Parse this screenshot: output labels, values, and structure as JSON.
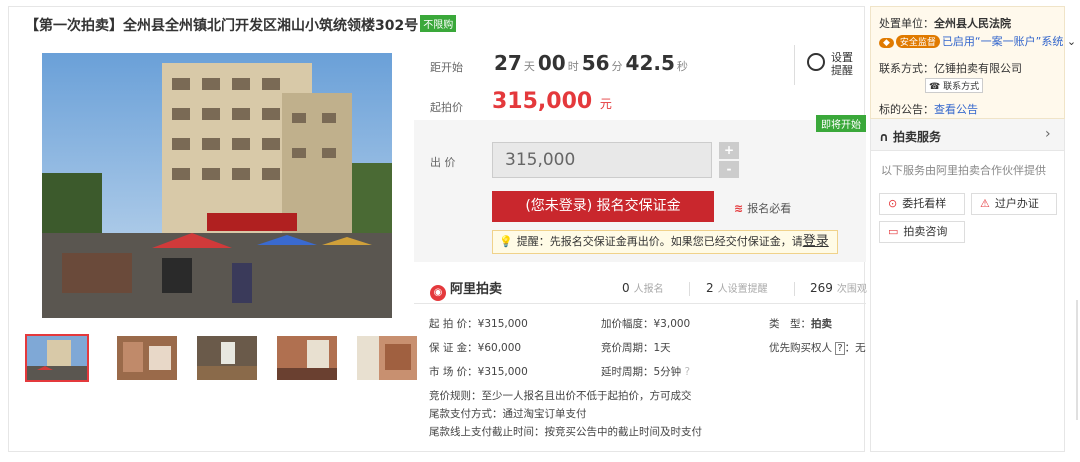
{
  "title": "【第一次拍卖】全州县全州镇北门开发区湘山小筑统领楼302号",
  "title_badge": "不限购",
  "countdown": {
    "label": "距开始",
    "days": "27",
    "days_unit": "天",
    "hours": "00",
    "hours_unit": "时",
    "minutes": "56",
    "minutes_unit": "分",
    "seconds": "42.5",
    "seconds_unit": "秒"
  },
  "start_price": {
    "label": "起拍价",
    "value": "315,000",
    "unit": "元"
  },
  "reminder": {
    "line1": "设置",
    "line2": "提醒",
    "icon": "clock-icon"
  },
  "status_tag": "即将开始",
  "bid": {
    "label": "出 价",
    "input_value": "315,000",
    "plus": "+",
    "minus": "-",
    "signup_button": "(您未登录) 报名交保证金",
    "must_read": "报名必看",
    "tip_prefix": "提醒：先报名交保证金再出价。如果您已经交付保证金，请",
    "tip_link": "登录"
  },
  "stats": {
    "brand": "阿里拍卖",
    "signup_count": "0",
    "signup_label": "人报名",
    "remind_count": "2",
    "remind_label": "人设置提醒",
    "view_count": "269",
    "view_label": "次围观"
  },
  "info": {
    "start_price": "起 拍 价：¥315,000",
    "increment": "加价幅度：¥3,000",
    "type_label": "类　型：",
    "type_value": "拍卖",
    "deposit": "保 证 金：¥60,000",
    "cycle": "竞价周期：1天",
    "priority": "优先购买权人",
    "priority_value": "：无",
    "market_price": "市 场 价：¥315,000",
    "delay": "延时周期：5分钟",
    "rule": "竞价规则：至少一人报名且出价不低于起拍价，方可成交",
    "payment": "尾款支付方式：通过淘宝订单支付",
    "deadline": "尾款线上支付截止时间：按竞买公告中的截止时间及时支付"
  },
  "side": {
    "org_label": "处置单位：",
    "org_value": "全州县人民法院",
    "safe_badge": "安全监督",
    "safe_text": "已启用“一案一账户”系统",
    "contact_label": "联系方式：",
    "contact_value": "亿锤拍卖有限公司",
    "contact_button": "联系方式",
    "notice_label": "标的公告：",
    "notice_link": "查看公告",
    "service_title": "拍卖服务",
    "service_desc": "以下服务由阿里拍卖合作伙伴提供",
    "btn_viewing": "委托看样",
    "btn_transfer": "过户办证",
    "btn_consult": "拍卖咨询"
  },
  "colors": {
    "accent_red": "#e4393c",
    "button_red": "#c9272d",
    "green": "#3aa83a",
    "link": "#3366cc"
  }
}
